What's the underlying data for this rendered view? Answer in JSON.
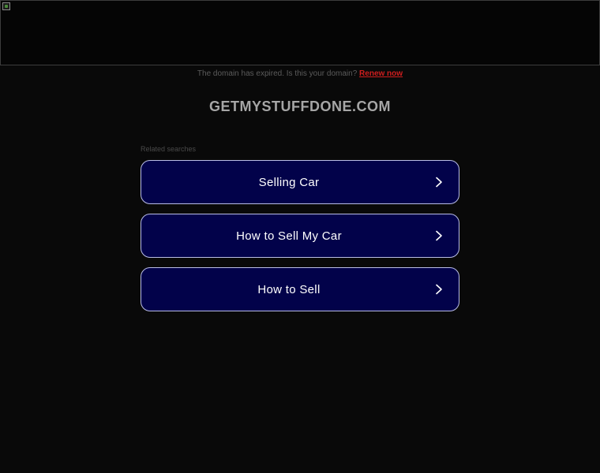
{
  "banner": {
    "image_alt": ""
  },
  "expired_notice": {
    "text": "The domain has expired. Is this your domain?",
    "renew_label": "Renew now"
  },
  "domain": {
    "title": "GETMYSTUFFDONE.COM"
  },
  "related": {
    "label": "Related searches",
    "items": [
      {
        "label": "Selling Car"
      },
      {
        "label": "How to Sell My Car"
      },
      {
        "label": "How to Sell"
      }
    ]
  },
  "colors": {
    "background": "#090909",
    "button_bg": "#02024a",
    "button_border": "#b9bde6",
    "renew_link": "#d01e1e"
  },
  "icons": {
    "chevron": "chevron-right-icon",
    "broken_image": "broken-image-icon"
  }
}
